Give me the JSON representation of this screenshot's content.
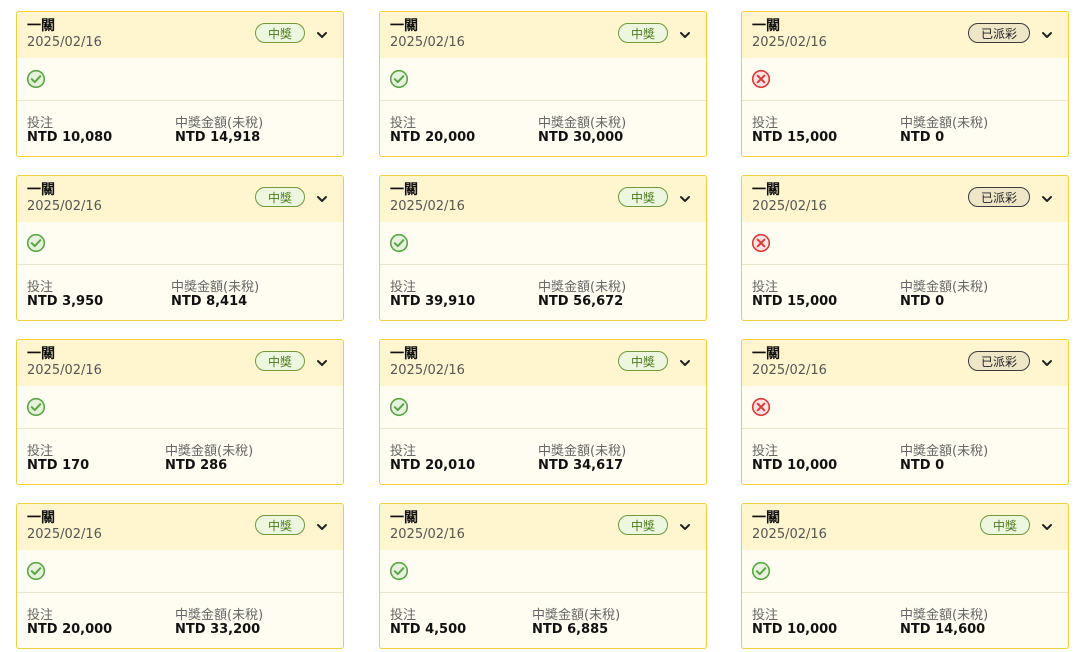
{
  "labels": {
    "stake": "投注",
    "prize": "中獎金額(未稅)"
  },
  "status_names": {
    "won": "中獎",
    "paid": "已派彩"
  },
  "icons": {
    "win_icon": "check-circle-icon",
    "loss_icon": "x-circle-icon",
    "expand_icon": "chevron-down-icon"
  },
  "colors": {
    "card_border": "#f0cf3e",
    "header_bg": "#fff5cf",
    "body_bg": "#fffdf1",
    "won_badge_text": "#4d7a1e",
    "won_badge_bg": "#edf6de",
    "paid_badge_bg": "#efe6c8",
    "check_green": "#5aa646",
    "cross_red": "#d93a3a"
  },
  "cards": [
    {
      "title": "一關",
      "date": "2025/02/16",
      "status": "中獎",
      "result": "win",
      "stake": "NTD 10,080",
      "prize": "NTD 14,918"
    },
    {
      "title": "一關",
      "date": "2025/02/16",
      "status": "中獎",
      "result": "win",
      "stake": "NTD 20,000",
      "prize": "NTD 30,000"
    },
    {
      "title": "一關",
      "date": "2025/02/16",
      "status": "已派彩",
      "result": "loss",
      "stake": "NTD 15,000",
      "prize": "NTD 0"
    },
    {
      "title": "一關",
      "date": "2025/02/16",
      "status": "中獎",
      "result": "win",
      "stake": "NTD 3,950",
      "prize": "NTD 8,414"
    },
    {
      "title": "一關",
      "date": "2025/02/16",
      "status": "中獎",
      "result": "win",
      "stake": "NTD 39,910",
      "prize": "NTD 56,672"
    },
    {
      "title": "一關",
      "date": "2025/02/16",
      "status": "已派彩",
      "result": "loss",
      "stake": "NTD 15,000",
      "prize": "NTD 0"
    },
    {
      "title": "一關",
      "date": "2025/02/16",
      "status": "中獎",
      "result": "win",
      "stake": "NTD 170",
      "prize": "NTD 286"
    },
    {
      "title": "一關",
      "date": "2025/02/16",
      "status": "中獎",
      "result": "win",
      "stake": "NTD 20,010",
      "prize": "NTD 34,617"
    },
    {
      "title": "一關",
      "date": "2025/02/16",
      "status": "已派彩",
      "result": "loss",
      "stake": "NTD 10,000",
      "prize": "NTD 0"
    },
    {
      "title": "一關",
      "date": "2025/02/16",
      "status": "中獎",
      "result": "win",
      "stake": "NTD 20,000",
      "prize": "NTD 33,200"
    },
    {
      "title": "一關",
      "date": "2025/02/16",
      "status": "中獎",
      "result": "win",
      "stake": "NTD 4,500",
      "prize": "NTD 6,885"
    },
    {
      "title": "一關",
      "date": "2025/02/16",
      "status": "中獎",
      "result": "win",
      "stake": "NTD 10,000",
      "prize": "NTD 14,600"
    }
  ]
}
